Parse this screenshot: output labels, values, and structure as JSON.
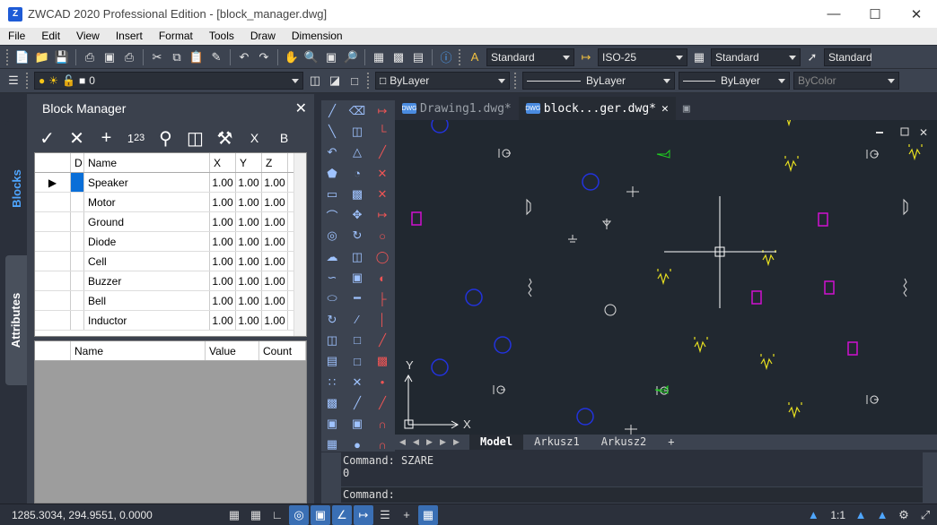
{
  "window": {
    "title": "ZWCAD 2020 Professional Edition - [block_manager.dwg]",
    "app_icon": "zwcad-logo-icon"
  },
  "menu": [
    "File",
    "Edit",
    "View",
    "Insert",
    "Format",
    "Tools",
    "Draw",
    "Dimension"
  ],
  "toolbar1": {
    "text_style": "Standard",
    "dim_style": "ISO-25",
    "table_style": "Standard",
    "mleader_style": "Standard"
  },
  "toolbar2": {
    "layer": "0",
    "color": "ByLayer",
    "linetype": "ByLayer",
    "lineweight": "ByLayer",
    "plotstyle": "ByColor"
  },
  "side_tabs": {
    "blocks": "Blocks",
    "attributes": "Attributes"
  },
  "block_manager": {
    "title": "Block Manager",
    "columns": [
      "D",
      "Name",
      "X",
      "Y",
      "Z"
    ],
    "rows": [
      {
        "name": "Speaker",
        "x": "1.00",
        "y": "1.00",
        "z": "1.00"
      },
      {
        "name": "Motor",
        "x": "1.00",
        "y": "1.00",
        "z": "1.00"
      },
      {
        "name": "Ground",
        "x": "1.00",
        "y": "1.00",
        "z": "1.00"
      },
      {
        "name": "Diode",
        "x": "1.00",
        "y": "1.00",
        "z": "1.00"
      },
      {
        "name": "Cell",
        "x": "1.00",
        "y": "1.00",
        "z": "1.00"
      },
      {
        "name": "Buzzer",
        "x": "1.00",
        "y": "1.00",
        "z": "1.00"
      },
      {
        "name": "Bell",
        "x": "1.00",
        "y": "1.00",
        "z": "1.00"
      },
      {
        "name": "Inductor",
        "x": "1.00",
        "y": "1.00",
        "z": "1.00"
      }
    ],
    "attr_columns": [
      "Name",
      "Value",
      "Count"
    ]
  },
  "doc_tabs": [
    "Drawing1.dwg*",
    "block...ger.dwg*"
  ],
  "axes": {
    "y": "Y",
    "x": "X"
  },
  "layout_tabs": [
    "Model",
    "Arkusz1",
    "Arkusz2",
    "+"
  ],
  "command": {
    "line1": "Command: SZARE",
    "line2": "0",
    "prompt": "Command:"
  },
  "status": {
    "coords": "1285.3034, 294.9551, 0.0000",
    "scale": "1:1"
  },
  "colors": {
    "canvas": "#212830",
    "panel": "#3b414d",
    "accent": "#3a6fb4"
  }
}
